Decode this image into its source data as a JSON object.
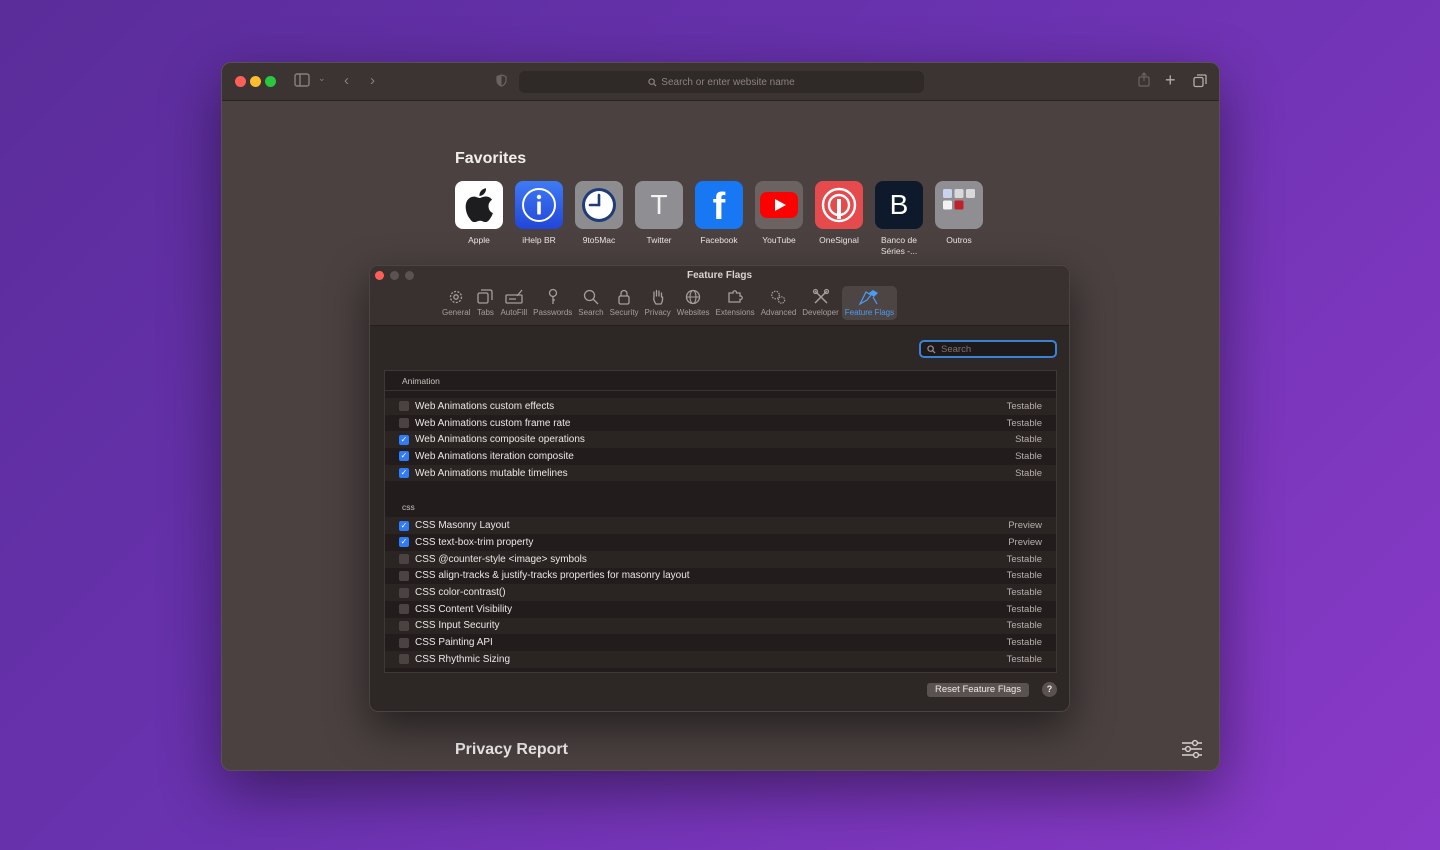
{
  "browser": {
    "address_placeholder": "Search or enter website name"
  },
  "favorites": {
    "title": "Favorites",
    "items": [
      {
        "label": "Apple",
        "icon": "apple-logo-icon"
      },
      {
        "label": "iHelp BR",
        "icon": "info-icon"
      },
      {
        "label": "9to5Mac",
        "icon": "clock-icon"
      },
      {
        "label": "Twitter",
        "icon": "letter-t-icon",
        "letter": "T"
      },
      {
        "label": "Facebook",
        "icon": "facebook-icon",
        "letter": "f"
      },
      {
        "label": "YouTube",
        "icon": "youtube-play-icon"
      },
      {
        "label": "OneSignal",
        "icon": "onesignal-icon"
      },
      {
        "label": "Banco de Séries -...",
        "icon": "letter-b-icon",
        "letter": "B"
      },
      {
        "label": "Outros",
        "icon": "folder-grid-icon"
      }
    ]
  },
  "privacy_report": {
    "title": "Privacy Report"
  },
  "dialog": {
    "title": "Feature Flags",
    "tabs": [
      {
        "label": "General",
        "icon": "gear-icon"
      },
      {
        "label": "Tabs",
        "icon": "tabs-icon"
      },
      {
        "label": "AutoFill",
        "icon": "autofill-icon"
      },
      {
        "label": "Passwords",
        "icon": "key-icon"
      },
      {
        "label": "Search",
        "icon": "magnifier-icon"
      },
      {
        "label": "Security",
        "icon": "lock-icon"
      },
      {
        "label": "Privacy",
        "icon": "hand-icon"
      },
      {
        "label": "Websites",
        "icon": "globe-icon"
      },
      {
        "label": "Extensions",
        "icon": "puzzle-icon"
      },
      {
        "label": "Advanced",
        "icon": "gears-icon"
      },
      {
        "label": "Developer",
        "icon": "tools-icon"
      },
      {
        "label": "Feature Flags",
        "icon": "flags-icon",
        "active": true
      }
    ],
    "search_placeholder": "Search",
    "groups": [
      {
        "title": "Animation",
        "rows": [
          {
            "label": "Web Animations custom effects",
            "status": "Testable",
            "checked": false
          },
          {
            "label": "Web Animations custom frame rate",
            "status": "Testable",
            "checked": false
          },
          {
            "label": "Web Animations composite operations",
            "status": "Stable",
            "checked": true
          },
          {
            "label": "Web Animations iteration composite",
            "status": "Stable",
            "checked": true
          },
          {
            "label": "Web Animations mutable timelines",
            "status": "Stable",
            "checked": true
          }
        ]
      },
      {
        "title": "CSS",
        "rows": [
          {
            "label": "CSS Masonry Layout",
            "status": "Preview",
            "checked": true
          },
          {
            "label": "CSS text-box-trim property",
            "status": "Preview",
            "checked": true
          },
          {
            "label": "CSS @counter-style <image> symbols",
            "status": "Testable",
            "checked": false
          },
          {
            "label": "CSS align-tracks & justify-tracks properties for masonry layout",
            "status": "Testable",
            "checked": false
          },
          {
            "label": "CSS color-contrast()",
            "status": "Testable",
            "checked": false
          },
          {
            "label": "CSS Content Visibility",
            "status": "Testable",
            "checked": false
          },
          {
            "label": "CSS Input Security",
            "status": "Testable",
            "checked": false
          },
          {
            "label": "CSS Painting API",
            "status": "Testable",
            "checked": false
          },
          {
            "label": "CSS Rhythmic Sizing",
            "status": "Testable",
            "checked": false
          }
        ]
      }
    ],
    "reset_label": "Reset Feature Flags",
    "help_label": "?"
  },
  "colors": {
    "accent": "#2e7cf6",
    "active_tab_text": "#4b9cf5"
  }
}
